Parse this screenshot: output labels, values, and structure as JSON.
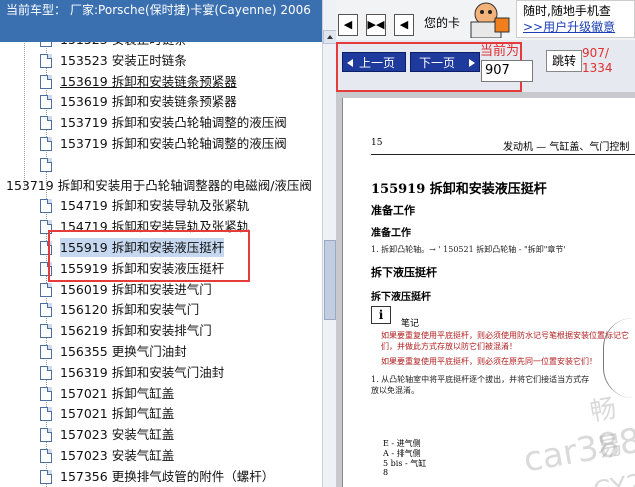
{
  "header": {
    "label": "当前车型：",
    "value": "厂家:Porsche(保时捷)卡宴(Cayenne) 2006"
  },
  "tree": {
    "items": [
      {
        "text": "151523 安装正时链条",
        "style": "",
        "top": 0
      },
      {
        "text": "153523 安装正时链条",
        "style": ""
      },
      {
        "text": "153619 拆卸和安装链条预紧器",
        "style": "ul"
      },
      {
        "text": "153619 拆卸和安装链条预紧器",
        "style": ""
      },
      {
        "text": "153719 拆卸和安装凸轮轴调整的液压阀",
        "style": ""
      },
      {
        "text": "153719 拆卸和安装凸轮轴调整的液压阀",
        "style": ""
      },
      {
        "text": "",
        "style": ""
      },
      {
        "text": "153719 拆卸和安装用于凸轮轴调整器的电磁阀/液压阀",
        "style": "root"
      },
      {
        "text": "154719 拆卸和安装导轨及张紧轨",
        "style": ""
      },
      {
        "text": "154719 拆卸和安装导轨及张紧轨",
        "style": ""
      },
      {
        "text": "155919 拆卸和安装液压挺杆",
        "style": "hl"
      },
      {
        "text": "155919 拆卸和安装液压挺杆",
        "style": ""
      },
      {
        "text": "156019 拆卸和安装进气门",
        "style": ""
      },
      {
        "text": "156120 拆卸和安装气门",
        "style": ""
      },
      {
        "text": "156219 拆卸和安装排气门",
        "style": ""
      },
      {
        "text": "156355 更换气门油封",
        "style": ""
      },
      {
        "text": "156319 拆卸和安装气门油封",
        "style": ""
      },
      {
        "text": "157021 拆卸气缸盖",
        "style": ""
      },
      {
        "text": "157021 拆卸气缸盖",
        "style": ""
      },
      {
        "text": "157023 安装气缸盖",
        "style": ""
      },
      {
        "text": "157023 安装气缸盖",
        "style": ""
      },
      {
        "text": "157356 更换排气歧管的附件（螺杆）",
        "style": ""
      }
    ]
  },
  "toolbar": {
    "btn1": "◀",
    "btn2": "▶◀",
    "btn3": "◀",
    "welcome": "您的卡",
    "promo_line1": "随时,随地手机查",
    "promo_line2": ">>用户升级徽意"
  },
  "nav": {
    "prev_label": "上一页",
    "next_label": "下一页",
    "current_label": "当前为",
    "page_value": "907",
    "goto_label": "跳转",
    "page_count": "907/\n1334"
  },
  "doc": {
    "page_number": "15",
    "header_right": "发动机 — 气缸盖、气门控制",
    "title": "155919 拆卸和安装液压挺杆",
    "prep_h": "准备工作",
    "prep_sub": "准备工作",
    "prep_step": "1.   拆卸凸轮轴。→ ' 150521 拆卸凸轮轴 - \"拆卸\"章节'",
    "remove_h": "拆下液压挺杆",
    "remove_sub": "拆下液压挺杆",
    "note_label": "笔记",
    "note1": "如果要重复使用平底挺杆，则必须使用防水记号笔根据安装位置标记它们，并做此方式存放以防它们被混淆！",
    "note2": "如果要重复使用平底挺杆，则必须在原先同一位置安装它们！",
    "step1": "1.  从凸轮轴室中将平底挺杆逐个拔出，并将它们接适当方式存放以免混淆。",
    "leg1": "E  - 进气侧",
    "leg2": "A  - 排气侧",
    "leg3": "5 bis  - 气缸",
    "leg4": "8",
    "wm1": "畅易",
    "wm2": "car388.c",
    "wm3": "CY201"
  },
  "colors": {
    "header_bg": "#3a6fb0",
    "nav_btn_bg": "#1d3a9c",
    "highlight": "#c6d8ef",
    "red_annotation": "#e53b3b"
  }
}
